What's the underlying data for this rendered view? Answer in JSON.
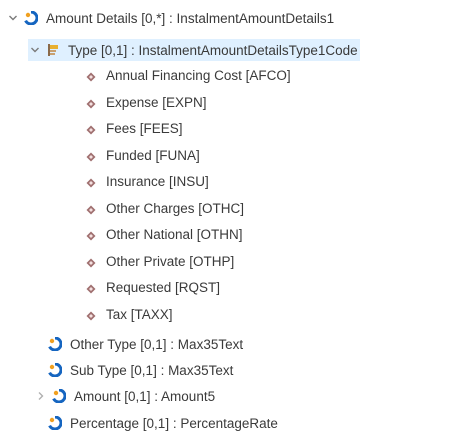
{
  "tree": {
    "root": {
      "label": "Amount Details [0,*] : InstalmentAmountDetails1",
      "expanded": true,
      "icon": "complex-element-icon"
    },
    "type_node": {
      "label": "Type [0,1] : InstalmentAmountDetailsType1Code",
      "expanded": true,
      "selected": true,
      "icon": "code-type-icon"
    },
    "enum_items": [
      "Annual Financing Cost [AFCO]",
      "Expense [EXPN]",
      "Fees [FEES]",
      "Funded [FUNA]",
      "Insurance [INSU]",
      "Other Charges [OTHC]",
      "Other National [OTHN]",
      "Other Private [OTHP]",
      "Requested [RQST]",
      "Tax [TAXX]"
    ],
    "children": [
      {
        "label": "Other Type [0,1] : Max35Text",
        "expandable": false
      },
      {
        "label": "Sub Type [0,1] : Max35Text",
        "expandable": false
      },
      {
        "label": "Amount [0,1] : Amount5",
        "expandable": true
      },
      {
        "label": "Percentage [0,1] : PercentageRate",
        "expandable": false
      }
    ]
  },
  "colors": {
    "element_icon": "#1565c0",
    "element_icon_accent": "#f0a020",
    "enum_icon": "#a07070",
    "selection": "#dff0ff",
    "text": "#3a3a3a"
  }
}
